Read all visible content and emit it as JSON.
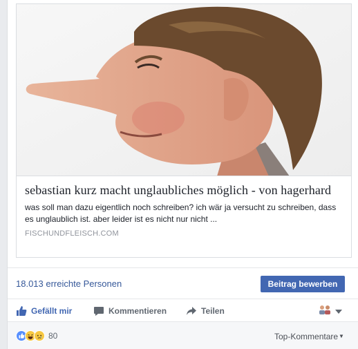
{
  "link_preview": {
    "title": "sebastian kurz macht unglaubliches möglich - von hagerhard",
    "description": "was soll man dazu eigentlich noch schreiben? ich wär ja versucht zu schreiben, dass es unglaublich ist. aber leider ist es nicht nur nicht ...",
    "domain": "FISCHUNDFLEISCH.COM"
  },
  "reach": {
    "text": "18.013 erreichte Personen",
    "boost_label": "Beitrag bewerben"
  },
  "actions": {
    "like_label": "Gefällt mir",
    "comment_label": "Kommentieren",
    "share_label": "Teilen"
  },
  "reactions": {
    "icons": [
      "like-reaction-icon",
      "haha-reaction-icon",
      "sad-reaction-icon"
    ],
    "count": "80",
    "top_comments_label": "Top-Kommentare"
  },
  "colors": {
    "accent": "#4267b2",
    "link": "#365899",
    "like_blue": "#5890ff",
    "emoji_yellow": "#f7c843"
  }
}
